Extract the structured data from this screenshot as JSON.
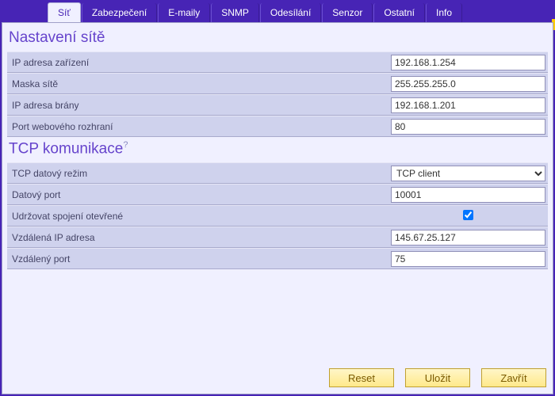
{
  "tabs": [
    {
      "label": "Síť",
      "active": true
    },
    {
      "label": "Zabezpečení",
      "active": false
    },
    {
      "label": "E-maily",
      "active": false
    },
    {
      "label": "SNMP",
      "active": false
    },
    {
      "label": "Odesílání",
      "active": false
    },
    {
      "label": "Senzor",
      "active": false
    },
    {
      "label": "Ostatní",
      "active": false
    },
    {
      "label": "Info",
      "active": false
    }
  ],
  "section1": {
    "title": "Nastavení sítě",
    "rows": {
      "ip_device": {
        "label": "IP adresa zařízení",
        "value": "192.168.1.254"
      },
      "netmask": {
        "label": "Maska sítě",
        "value": "255.255.255.0"
      },
      "ip_gateway": {
        "label": "IP adresa brány",
        "value": "192.168.1.201"
      },
      "web_port": {
        "label": "Port webového rozhraní",
        "value": "80"
      }
    }
  },
  "section2": {
    "title": "TCP komunikace",
    "help": "?",
    "rows": {
      "tcp_mode": {
        "label": "TCP datový režim",
        "value": "TCP client",
        "options": [
          "TCP client"
        ]
      },
      "data_port": {
        "label": "Datový port",
        "value": "10001"
      },
      "keep_open": {
        "label": "Udržovat spojení otevřené",
        "checked": true
      },
      "remote_ip": {
        "label": "Vzdálená IP adresa",
        "value": "145.67.25.127"
      },
      "remote_port": {
        "label": "Vzdálený port",
        "value": "75"
      }
    }
  },
  "buttons": {
    "reset": "Reset",
    "save": "Uložit",
    "close": "Zavřít"
  }
}
